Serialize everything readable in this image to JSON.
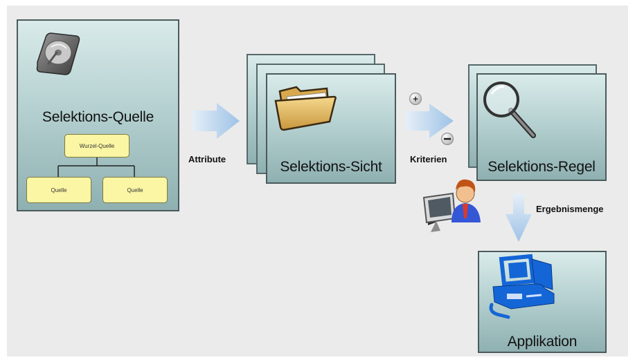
{
  "nodes": {
    "source_title": "Selektions-Quelle",
    "view_title": "Selektions-Sicht",
    "rule_title": "Selektions-Regel",
    "app_title": "Applikation"
  },
  "tree": {
    "root": "Wurzel-Quelle",
    "child_left": "Quelle",
    "child_right": "Quelle"
  },
  "edges": {
    "attribute_label": "Attribute",
    "criteria_label": "Kriterien",
    "result_label": "Ergebnismenge",
    "plus_symbol": "+",
    "minus_symbol": "−"
  },
  "icons": [
    "hard-disk-icon",
    "folder-icon",
    "magnifier-icon",
    "user-at-computer-icon",
    "computer-icon"
  ],
  "colors": {
    "card_top": "#d9ebea",
    "card_bottom": "#8fb0b1",
    "arrow": "#a9c9e8",
    "tree_box": "#fbf6a4"
  }
}
